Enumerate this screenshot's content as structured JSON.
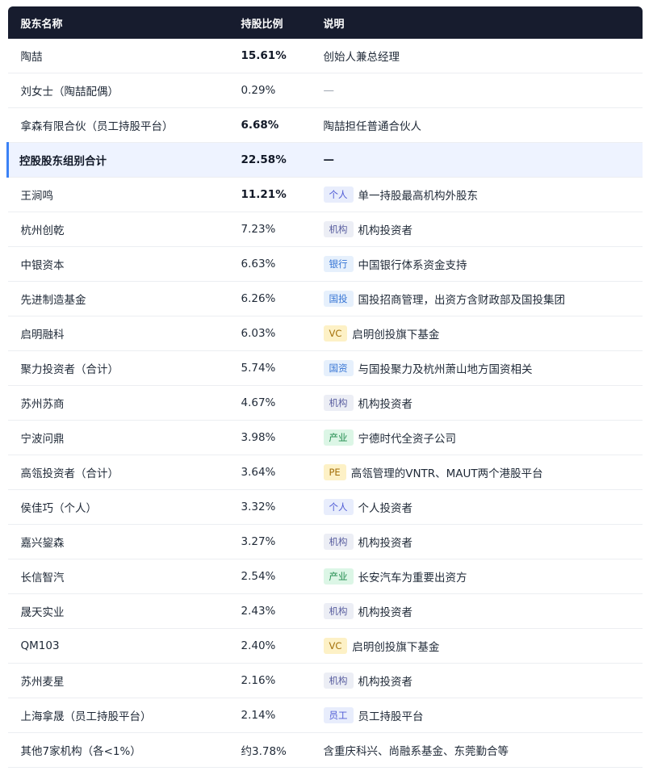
{
  "header": {
    "col_name": "股东名称",
    "col_pct": "持股比例",
    "col_note": "说明"
  },
  "rows": [
    {
      "name": "陶喆",
      "pct": "15.61%",
      "tag": "",
      "note": "创始人兼总经理"
    },
    {
      "name": "刘女士（陶喆配偶）",
      "pct": "0.29%",
      "tag": "",
      "note": "—"
    },
    {
      "name": "拿森有限合伙（员工持股平台）",
      "pct": "6.68%",
      "tag": "",
      "note": "陶喆担任普通合伙人"
    },
    {
      "name": "控股股东组别合计",
      "pct": "22.58%",
      "tag": "",
      "note": "—"
    },
    {
      "name": "王涧鸣",
      "pct": "11.21%",
      "tag": "个人",
      "note": "单一持股最高机构外股东"
    },
    {
      "name": "杭州创乾",
      "pct": "7.23%",
      "tag": "机构",
      "note": "机构投资者"
    },
    {
      "name": "中银资本",
      "pct": "6.63%",
      "tag": "银行",
      "note": "中国银行体系资金支持"
    },
    {
      "name": "先进制造基金",
      "pct": "6.26%",
      "tag": "国投",
      "note": "国投招商管理，出资方含财政部及国投集团"
    },
    {
      "name": "启明融科",
      "pct": "6.03%",
      "tag": "VC",
      "note": "启明创投旗下基金"
    },
    {
      "name": "聚力投资者（合计）",
      "pct": "5.74%",
      "tag": "国资",
      "note": "与国投聚力及杭州萧山地方国资相关"
    },
    {
      "name": "苏州苏商",
      "pct": "4.67%",
      "tag": "机构",
      "note": "机构投资者"
    },
    {
      "name": "宁波问鼎",
      "pct": "3.98%",
      "tag": "产业",
      "note": "宁德时代全资子公司"
    },
    {
      "name": "高瓴投资者（合计）",
      "pct": "3.64%",
      "tag": "PE",
      "note": "高瓴管理的VNTR、MAUT两个港股平台"
    },
    {
      "name": "侯佳巧（个人）",
      "pct": "3.32%",
      "tag": "个人",
      "note": "个人投资者"
    },
    {
      "name": "嘉兴鋆森",
      "pct": "3.27%",
      "tag": "机构",
      "note": "机构投资者"
    },
    {
      "name": "长信智汽",
      "pct": "2.54%",
      "tag": "产业",
      "note": "长安汽车为重要出资方"
    },
    {
      "name": "晟天实业",
      "pct": "2.43%",
      "tag": "机构",
      "note": "机构投资者"
    },
    {
      "name": "QM103",
      "pct": "2.40%",
      "tag": "VC",
      "note": "启明创投旗下基金"
    },
    {
      "name": "苏州麦星",
      "pct": "2.16%",
      "tag": "机构",
      "note": "机构投资者"
    },
    {
      "name": "上海拿晟（员工持股平台）",
      "pct": "2.14%",
      "tag": "员工",
      "note": "员工持股平台"
    },
    {
      "name": "其他7家机构（各<1%）",
      "pct": "约3.78%",
      "tag": "",
      "note": "含重庆科兴、尚融系基金、东莞勤合等"
    }
  ],
  "colors": {
    "header_bg": "#171c2e",
    "highlight_bg": "#eef3ff",
    "highlight_bar": "#3b82f6"
  }
}
